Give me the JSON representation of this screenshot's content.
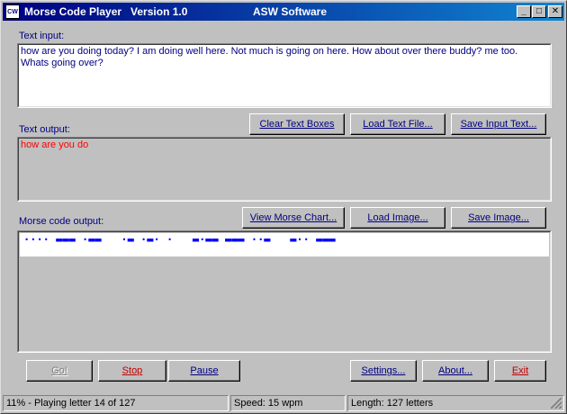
{
  "window": {
    "title": "Morse Code Player   Version 1.0",
    "company": "ASW Software",
    "icon_text": "CW",
    "controls": {
      "minimize": "_",
      "maximize": "□",
      "close": "✕"
    }
  },
  "text_input": {
    "label": "Text input:",
    "value": "how are you doing today? I am doing well here. Not much is going on here. How about over there buddy? me too. Whats going over?"
  },
  "text_output": {
    "label": "Text output:",
    "value": "how are you do",
    "text_color": "#ff0000"
  },
  "text_buttons": {
    "clear": "Clear Text Boxes",
    "load_text": "Load Text File...",
    "save_input": "Save Input Text..."
  },
  "morse_output": {
    "label": "Morse code output:",
    "value": "···· ▬▬▬ ·▬▬   ·▬ ·▬· ·   ▬·▬▬ ▬▬▬ ··▬   ▬·· ▬▬▬",
    "color": "#0000ff"
  },
  "morse_buttons": {
    "view_chart": "View Morse Chart...",
    "load_image": "Load Image...",
    "save_image": "Save Image..."
  },
  "player_buttons": {
    "go": "Go!",
    "stop": "Stop",
    "pause": "Pause",
    "settings": "Settings...",
    "about": "About...",
    "exit": "Exit"
  },
  "status_bar": {
    "progress": "11% - Playing letter 14 of 127",
    "speed": "Speed: 15 wpm",
    "length": "Length: 127 letters"
  },
  "colors": {
    "label_blue": "#000080",
    "accent_red": "#c00000",
    "titlebar_start": "#000080",
    "titlebar_end": "#1084d0"
  }
}
